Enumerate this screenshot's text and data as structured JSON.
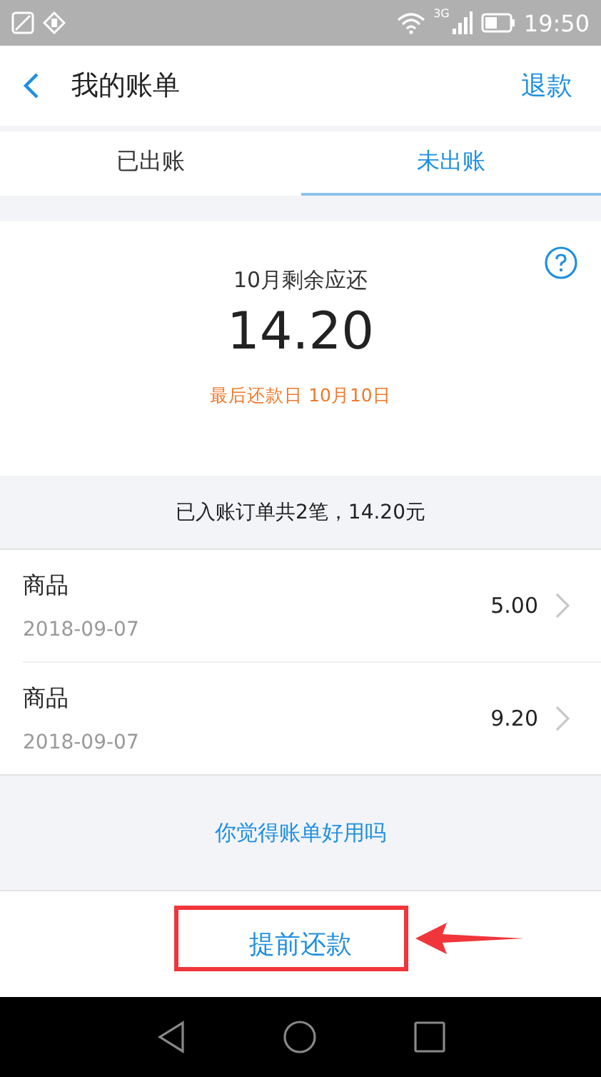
{
  "status_bar": {
    "network": "3G",
    "time": "19:50"
  },
  "header": {
    "title": "我的账单",
    "action": "退款"
  },
  "tabs": [
    {
      "label": "已出账",
      "selected": false
    },
    {
      "label": "未出账",
      "selected": true
    }
  ],
  "summary": {
    "caption": "10月剩余应还",
    "amount": "14.20",
    "due": "最后还款日 10月10日"
  },
  "orders_summary": "已入账订单共2笔，14.20元",
  "orders": [
    {
      "name": "商品",
      "date": "2018-09-07",
      "amount": "5.00"
    },
    {
      "name": "商品",
      "date": "2018-09-07",
      "amount": "9.20"
    }
  ],
  "feedback_link": "你觉得账单好用吗",
  "primary_button": "提前还款"
}
